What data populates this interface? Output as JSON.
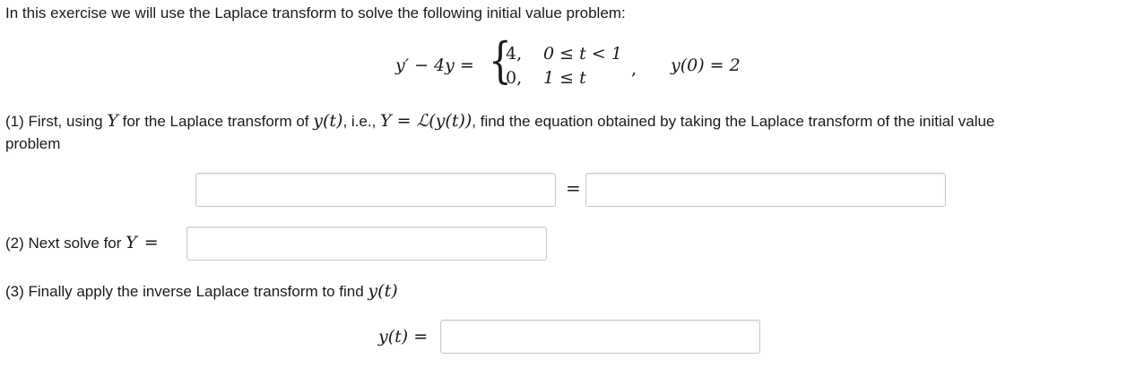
{
  "intro": "In this exercise we will use the Laplace transform to solve the following initial value problem:",
  "equation": {
    "lhs": "y′ − 4y =",
    "case1_val": "4,",
    "case1_cond": "0 ≤ t < 1",
    "case2_val": "0,",
    "case2_cond": "1 ≤ t",
    "comma": ",",
    "initial": "y(0) = 2"
  },
  "part1": {
    "line1_a": "(1) First, using ",
    "Y": "Y",
    "line1_b": " for the Laplace transform of ",
    "yt": "y(t)",
    "line1_c": ", i.e., ",
    "def": "Y = ℒ(y(t))",
    "line1_d": ", find the equation obtained by taking the Laplace transform of the initial value",
    "line2": "problem",
    "equals": "=",
    "lhs_value": "",
    "rhs_value": ""
  },
  "part2": {
    "label": "(2) Next solve for ",
    "Y": "Y",
    "equals": "=",
    "value": ""
  },
  "part3": {
    "label": "(3) Finally apply the inverse Laplace transform to find ",
    "yt": "y(t)",
    "answer_label": "y(t) =",
    "value": ""
  }
}
